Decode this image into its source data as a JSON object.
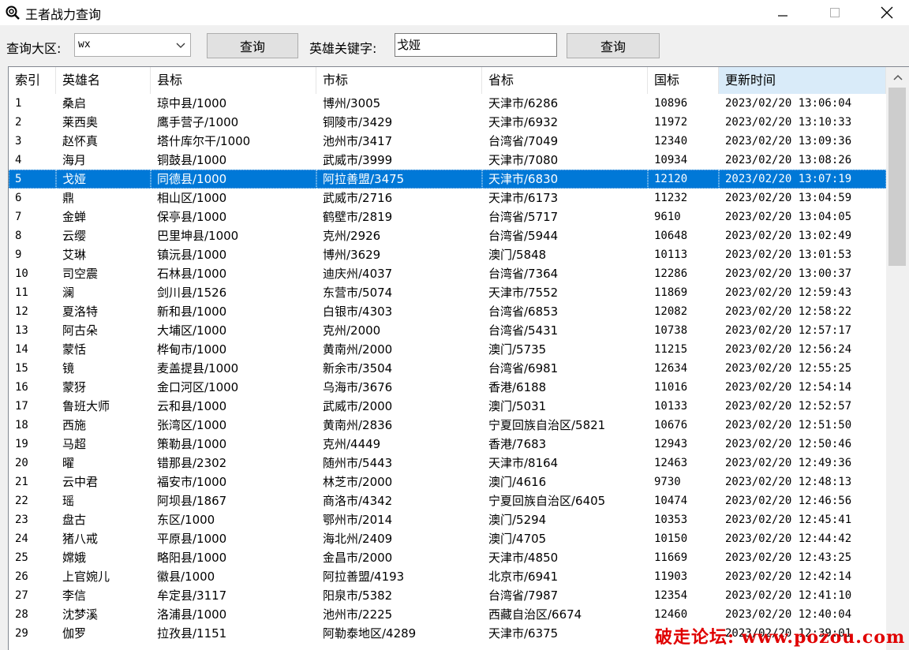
{
  "window": {
    "title": "王者战力查询",
    "minimize": "—",
    "maximize": "☐",
    "close": "✕"
  },
  "toolbar": {
    "region_label": "查询大区:",
    "region_value": "wx",
    "query_button_1": "查询",
    "hero_label": "英雄关键字:",
    "hero_value": "戈娅",
    "query_button_2": "查询"
  },
  "table": {
    "columns": [
      "索引",
      "英雄名",
      "县标",
      "市标",
      "省标",
      "国标",
      "更新时间"
    ],
    "sorted_column": 6,
    "selected_row": 4,
    "rows": [
      [
        "1",
        "桑启",
        "琼中县/1000",
        "博州/3005",
        "天津市/6286",
        "10896",
        "2023/02/20 13:06:04"
      ],
      [
        "2",
        "莱西奥",
        "鹰手营子/1000",
        "铜陵市/3429",
        "天津市/6932",
        "11972",
        "2023/02/20 13:10:33"
      ],
      [
        "3",
        "赵怀真",
        "塔什库尔干/1000",
        "池州市/3417",
        "台湾省/7049",
        "12340",
        "2023/02/20 13:09:36"
      ],
      [
        "4",
        "海月",
        "铜鼓县/1000",
        "武威市/3999",
        "天津市/7080",
        "10934",
        "2023/02/20 13:08:26"
      ],
      [
        "5",
        "戈娅",
        "同德县/1000",
        "阿拉善盟/3475",
        "天津市/6830",
        "12120",
        "2023/02/20 13:07:19"
      ],
      [
        "6",
        "鼎",
        "相山区/1000",
        "武威市/2716",
        "天津市/6173",
        "11232",
        "2023/02/20 13:04:59"
      ],
      [
        "7",
        "金蝉",
        "保亭县/1000",
        "鹤壁市/2819",
        "台湾省/5717",
        "9610",
        "2023/02/20 13:04:05"
      ],
      [
        "8",
        "云缨",
        "巴里坤县/1000",
        "克州/2926",
        "台湾省/5944",
        "10648",
        "2023/02/20 13:02:49"
      ],
      [
        "9",
        "艾琳",
        "镇沅县/1000",
        "博州/3629",
        "澳门/5848",
        "10113",
        "2023/02/20 13:01:53"
      ],
      [
        "10",
        "司空震",
        "石林县/1000",
        "迪庆州/4037",
        "台湾省/7364",
        "12286",
        "2023/02/20 13:00:37"
      ],
      [
        "11",
        "澜",
        "剑川县/1526",
        "东营市/5074",
        "天津市/7552",
        "11869",
        "2023/02/20 12:59:43"
      ],
      [
        "12",
        "夏洛特",
        "新和县/1000",
        "白银市/4303",
        "台湾省/6853",
        "12082",
        "2023/02/20 12:58:22"
      ],
      [
        "13",
        "阿古朵",
        "大埔区/1000",
        "克州/2000",
        "台湾省/5431",
        "10738",
        "2023/02/20 12:57:17"
      ],
      [
        "14",
        "蒙恬",
        "桦甸市/1000",
        "黄南州/2000",
        "澳门/5735",
        "11215",
        "2023/02/20 12:56:24"
      ],
      [
        "15",
        "镜",
        "麦盖提县/1000",
        "新余市/3504",
        "台湾省/6981",
        "12634",
        "2023/02/20 12:55:25"
      ],
      [
        "16",
        "蒙犽",
        "金口河区/1000",
        "乌海市/3676",
        "香港/6188",
        "11016",
        "2023/02/20 12:54:14"
      ],
      [
        "17",
        "鲁班大师",
        "云和县/1000",
        "武威市/2000",
        "澳门/5031",
        "10133",
        "2023/02/20 12:52:57"
      ],
      [
        "18",
        "西施",
        "张湾区/1000",
        "黄南州/2836",
        "宁夏回族自治区/5821",
        "10676",
        "2023/02/20 12:51:50"
      ],
      [
        "19",
        "马超",
        "策勒县/1000",
        "克州/4449",
        "香港/7683",
        "12943",
        "2023/02/20 12:50:46"
      ],
      [
        "20",
        "曜",
        "错那县/2302",
        "随州市/5443",
        "天津市/8164",
        "12463",
        "2023/02/20 12:49:36"
      ],
      [
        "21",
        "云中君",
        "福安市/1000",
        "林芝市/2000",
        "澳门/4616",
        "9730",
        "2023/02/20 12:48:13"
      ],
      [
        "22",
        "瑶",
        "阿坝县/1867",
        "商洛市/4342",
        "宁夏回族自治区/6405",
        "10474",
        "2023/02/20 12:46:56"
      ],
      [
        "23",
        "盘古",
        "东区/1000",
        "鄂州市/2014",
        "澳门/5294",
        "10353",
        "2023/02/20 12:45:41"
      ],
      [
        "24",
        "猪八戒",
        "平原县/1000",
        "海北州/2409",
        "澳门/4705",
        "10150",
        "2023/02/20 12:44:42"
      ],
      [
        "25",
        "嫦娥",
        "略阳县/1000",
        "金昌市/2000",
        "天津市/4850",
        "11669",
        "2023/02/20 12:43:25"
      ],
      [
        "26",
        "上官婉儿",
        "徽县/1000",
        "阿拉善盟/4193",
        "北京市/6941",
        "11903",
        "2023/02/20 12:42:14"
      ],
      [
        "27",
        "李信",
        "牟定县/3117",
        "阳泉市/5382",
        "台湾省/7987",
        "12354",
        "2023/02/20 12:41:10"
      ],
      [
        "28",
        "沈梦溪",
        "洛浦县/1000",
        "池州市/2225",
        "西藏自治区/6674",
        "12460",
        "2023/02/20 12:40:04"
      ],
      [
        "29",
        "伽罗",
        "拉孜县/1151",
        "阿勒泰地区/4289",
        "天津市/6375",
        "",
        "2023/02/20 12:39:01"
      ]
    ]
  },
  "watermark": "破走论坛: www.pozou.com",
  "colors": {
    "selection": "#0078d7",
    "sorted_header": "#d9ebf9",
    "watermark": "#e00000"
  },
  "icons": {
    "app": "search-icon",
    "scroll_up": "chevron-up-icon",
    "combo_arrow": "chevron-down-icon"
  }
}
